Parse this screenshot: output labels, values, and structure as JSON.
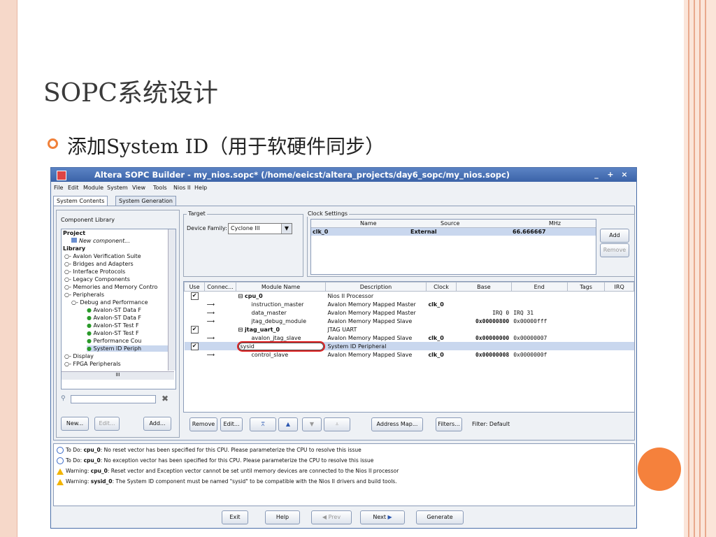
{
  "slide": {
    "title": "SOPC系统设计",
    "bullet": "添加System ID（用于软硬件同步）"
  },
  "colors": {
    "accent": "#f5813c",
    "titlebar": "#3b63a8",
    "selection": "#c9d7ee"
  },
  "window": {
    "title": "Altera SOPC Builder - my_nios.sopc* (/home/eeicst/altera_projects/day6_sopc/my_nios.sopc)",
    "menu": [
      "File",
      "Edit",
      "Module",
      "System",
      "View",
      "Tools",
      "Nios II",
      "Help"
    ],
    "tabs": [
      "System Contents",
      "System Generation"
    ]
  },
  "library": {
    "label": "Component Library",
    "project": "Project",
    "new_component": "New component...",
    "library": "Library",
    "items": [
      "Avalon Verification Suite",
      "Bridges and Adapters",
      "Interface Protocols",
      "Legacy Components",
      "Memories and Memory Contro",
      "Peripherals"
    ],
    "debug": "Debug and Performance",
    "debug_items": [
      "Avalon-ST Data F",
      "Avalon-ST Data F",
      "Avalon-ST Test F",
      "Avalon-ST Test F",
      "Performance Cou",
      "System ID Periph"
    ],
    "more": [
      "Display",
      "FPGA Peripherals"
    ],
    "scroll_label": "III",
    "search_placeholder": "",
    "new_btn": "New...",
    "edit_btn": "Edit...",
    "add_btn": "Add..."
  },
  "target": {
    "label": "Target",
    "device_family_label": "Device Family:",
    "device_family": "Cyclone III"
  },
  "clock": {
    "label": "Clock Settings",
    "headers": [
      "Name",
      "Source",
      "MHz"
    ],
    "row": {
      "name": "clk_0",
      "source": "External",
      "mhz": "66.666667"
    },
    "add": "Add",
    "remove": "Remove"
  },
  "table": {
    "headers": [
      "Use",
      "Connec...",
      "Module Name",
      "Description",
      "Clock",
      "Base",
      "End",
      "Tags",
      "IRQ"
    ],
    "rows": [
      {
        "use": true,
        "module": "cpu_0",
        "desc": "Nios II Processor",
        "clock": "",
        "base": "",
        "end": "",
        "bold": true,
        "expander": "⊟",
        "indent": 0
      },
      {
        "use": null,
        "module": "instruction_master",
        "desc": "Avalon Memory Mapped Master",
        "clock": "clk_0",
        "base": "",
        "end": "",
        "indent": 1
      },
      {
        "use": null,
        "module": "data_master",
        "desc": "Avalon Memory Mapped Master",
        "clock": "",
        "base": "IRQ 0",
        "end": "IRQ 31",
        "indent": 1
      },
      {
        "use": null,
        "module": "jtag_debug_module",
        "desc": "Avalon Memory Mapped Slave",
        "clock": "",
        "base": "0x00000800",
        "end": "0x00000fff",
        "indent": 1
      },
      {
        "use": true,
        "module": "jtag_uart_0",
        "desc": "JTAG UART",
        "clock": "",
        "base": "",
        "end": "",
        "bold": true,
        "expander": "⊟",
        "indent": 0
      },
      {
        "use": null,
        "module": "avalon_jtag_slave",
        "desc": "Avalon Memory Mapped Slave",
        "clock": "clk_0",
        "base": "0x00000000",
        "end": "0x00000007",
        "indent": 1
      },
      {
        "use": true,
        "module": "sysid",
        "desc": "System ID Peripheral",
        "clock": "",
        "base": "",
        "end": "",
        "editing": true,
        "indent": 0
      },
      {
        "use": null,
        "module": "control_slave",
        "desc": "Avalon Memory Mapped Slave",
        "clock": "clk_0",
        "base": "0x00000008",
        "end": "0x0000000f",
        "indent": 1
      }
    ]
  },
  "toolbar": {
    "remove": "Remove",
    "edit": "Edit...",
    "address_map": "Address Map...",
    "filters": "Filters...",
    "filter_label": "Filter: Default"
  },
  "messages": [
    {
      "type": "todo",
      "prefix": "To Do: ",
      "name": "cpu_0",
      "text": ": No reset vector has been specified for this CPU. Please parameterize the CPU to resolve this issue"
    },
    {
      "type": "todo",
      "prefix": "To Do: ",
      "name": "cpu_0",
      "text": ": No exception vector has been specified for this CPU. Please parameterize the CPU to resolve this issue"
    },
    {
      "type": "warn",
      "prefix": "Warning: ",
      "name": "cpu_0",
      "text": ": Reset vector and Exception vector cannot be set until memory devices are connected to the Nios II processor"
    },
    {
      "type": "warn",
      "prefix": "Warning: ",
      "name": "sysid_0",
      "text": ": The System ID component must be named \"sysid\" to be compatible with the Nios II drivers and build tools."
    }
  ],
  "bottom": {
    "exit": "Exit",
    "help": "Help",
    "prev": "Prev",
    "next": "Next",
    "generate": "Generate"
  }
}
